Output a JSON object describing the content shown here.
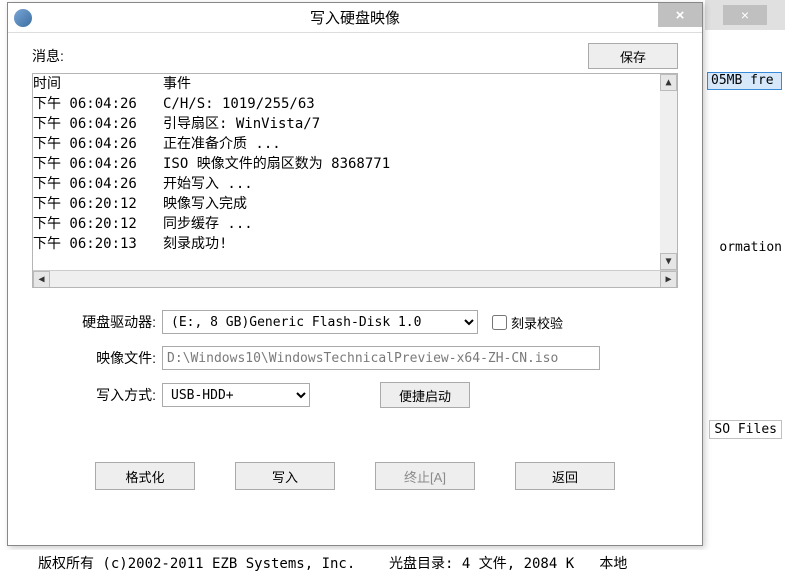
{
  "bg": {
    "close_x": "×",
    "free_label": "05MB fre",
    "ormation": "ormation",
    "sofiles": "SO Files"
  },
  "dialog": {
    "title": "写入硬盘映像",
    "close_x": "×",
    "msg_label": "消息:",
    "save_label": "保存",
    "log": {
      "h_time": "时间",
      "h_event": "事件",
      "rows": [
        {
          "t": "下午 06:04:26",
          "e": "C/H/S: 1019/255/63"
        },
        {
          "t": "下午 06:04:26",
          "e": "引导扇区: WinVista/7"
        },
        {
          "t": "下午 06:04:26",
          "e": "正在准备介质 ..."
        },
        {
          "t": "下午 06:04:26",
          "e": "ISO 映像文件的扇区数为 8368771"
        },
        {
          "t": "下午 06:04:26",
          "e": "开始写入 ..."
        },
        {
          "t": "下午 06:20:12",
          "e": "映像写入完成"
        },
        {
          "t": "下午 06:20:12",
          "e": "同步缓存 ..."
        },
        {
          "t": "下午 06:20:13",
          "e": "刻录成功!"
        }
      ]
    },
    "form": {
      "drive_label": "硬盘驱动器:",
      "drive_value": "(E:, 8 GB)Generic Flash-Disk      1.0",
      "check_label": "刻录校验",
      "image_label": "映像文件:",
      "image_value": "D:\\Windows10\\WindowsTechnicalPreview-x64-ZH-CN.iso",
      "mode_label": "写入方式:",
      "mode_value": "USB-HDD+",
      "quickboot_label": "便捷启动"
    },
    "buttons": {
      "format": "格式化",
      "write": "写入",
      "stop": "终止[A]",
      "back": "返回"
    }
  },
  "status": {
    "copyright": "版权所有 (c)2002-2011 EZB Systems, Inc.    光盘目录: 4 文件, 2084 K   本地"
  }
}
